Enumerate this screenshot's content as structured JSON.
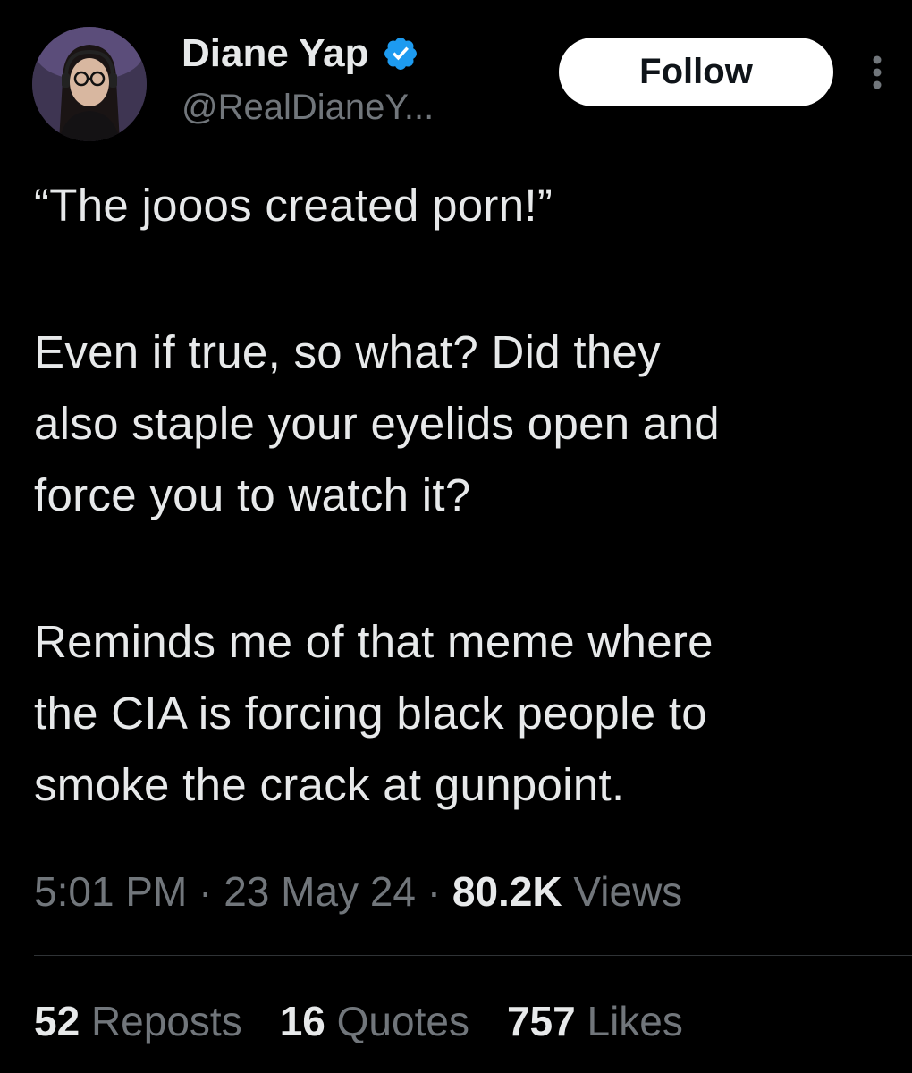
{
  "user": {
    "display_name": "Diane Yap",
    "handle": "@RealDianeY...",
    "verified_icon": "verified-badge-icon",
    "verified_color": "#1d9bf0"
  },
  "follow_button": {
    "label": "Follow"
  },
  "more_menu": {
    "icon": "more-vertical-icon"
  },
  "tweet": {
    "paragraphs": [
      "“The jooos created porn!”",
      "Even if true, so what? Did they\nalso staple your eyelids open and\nforce you to watch it?",
      "Reminds me of that meme where\nthe CIA is forcing black people to\nsmoke the crack at gunpoint."
    ]
  },
  "meta": {
    "time": "5:01 PM",
    "separator": "·",
    "date": "23 May 24",
    "views_count": "80.2K",
    "views_label": "Views"
  },
  "stats": {
    "reposts_count": "52",
    "reposts_label": "Reposts",
    "quotes_count": "16",
    "quotes_label": "Quotes",
    "likes_count": "757",
    "likes_label": "Likes"
  },
  "colors": {
    "background": "#000000",
    "primary_text": "#e7e9ea",
    "secondary_text": "#71767b",
    "divider": "#2f3336",
    "follow_bg": "#ffffff"
  }
}
